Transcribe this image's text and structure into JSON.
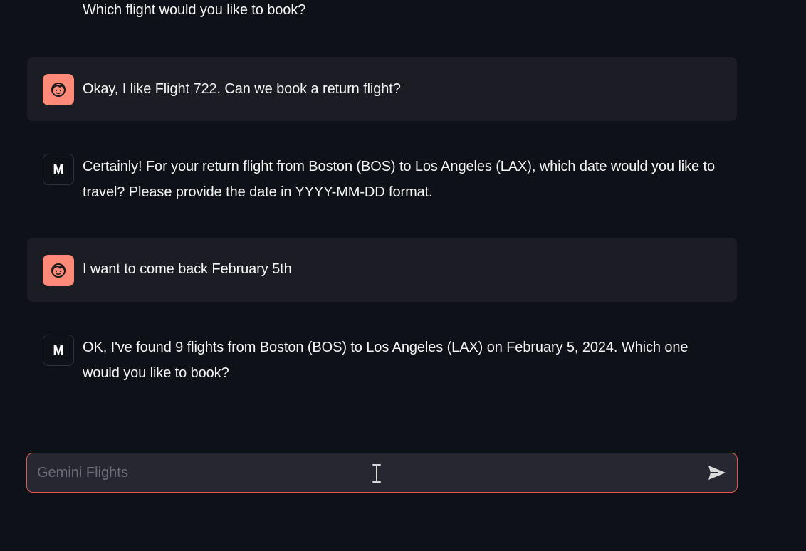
{
  "chat": {
    "messages": [
      {
        "role": "assistant",
        "text": "Which flight would you like to book?"
      },
      {
        "role": "user",
        "text": "Okay, I like Flight 722. Can we book a return flight?"
      },
      {
        "role": "assistant",
        "avatar_label": "M",
        "text": "Certainly! For your return flight from Boston (BOS) to Los Angeles (LAX), which date would you like to travel? Please provide the date in YYYY-MM-DD format."
      },
      {
        "role": "user",
        "text": "I want to come back February 5th"
      },
      {
        "role": "assistant",
        "avatar_label": "M",
        "text": "OK, I've found 9 flights from Boston (BOS) to Los Angeles (LAX) on February 5, 2024. Which one would you like to book?"
      }
    ]
  },
  "composer": {
    "placeholder": "Gemini Flights",
    "value": ""
  },
  "icons": {
    "user_avatar": "face-icon",
    "send": "send-arrow-icon",
    "cursor": "text-cursor-icon"
  },
  "colors": {
    "background": "#0e1117",
    "user_message_bg": "#1a1c24",
    "user_avatar_bg": "#ff8a7a",
    "input_border": "#e0584e",
    "input_bg": "#262730"
  }
}
